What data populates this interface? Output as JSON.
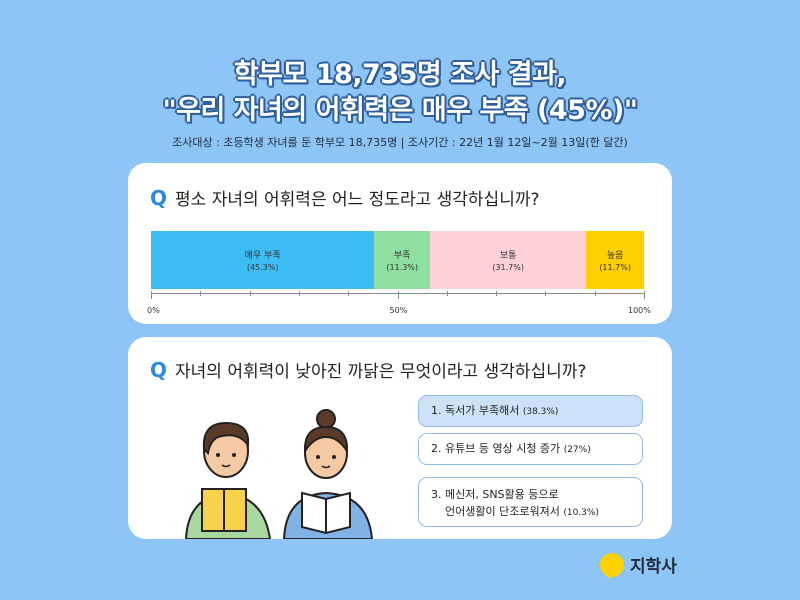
{
  "title": {
    "line1": "학부모 18,735명 조사 결과,",
    "line2": "\"우리 자녀의 어휘력은 매우 부족 (45%)\""
  },
  "subtitle": "조사대상 : 초등학생 자녀를 둔 학부모 18,735명  |  조사기간 : 22년 1월 12일~2월 13일(한 달간)",
  "q_mark": "Q",
  "q1": "평소 자녀의 어휘력은 어느 정도라고 생각하십니까?",
  "q2": "자녀의 어휘력이 낮아진 까닭은 무엇이라고 생각하십니까?",
  "chart_data": {
    "type": "bar",
    "stacked": true,
    "orientation": "horizontal",
    "categories": [
      "매우 부족",
      "부족",
      "보통",
      "높음"
    ],
    "values": [
      45.3,
      11.3,
      31.7,
      11.7
    ],
    "value_labels": [
      "(45.3%)",
      "(11.3%)",
      "(31.7%)",
      "(11.7%)"
    ],
    "colors": [
      "#3cbef5",
      "#8edfa0",
      "#ffd0d8",
      "#ffd000"
    ],
    "xlim": [
      0,
      100
    ],
    "tick_labels": [
      "0%",
      "50%",
      "100%"
    ]
  },
  "q2_options": [
    {
      "label": "1. 독서가 부족해서",
      "pct": "(38.3%)"
    },
    {
      "label": "2. 유튜브 등 영상 시청 증가",
      "pct": "(27%)"
    },
    {
      "label_line1": "3. 메신저, SNS활용 등으로",
      "label_line2": "언어생활이 단조로워져서",
      "pct": "(10.3%)"
    }
  ],
  "logo": {
    "text": "지학사",
    "color": "#ffd200"
  }
}
